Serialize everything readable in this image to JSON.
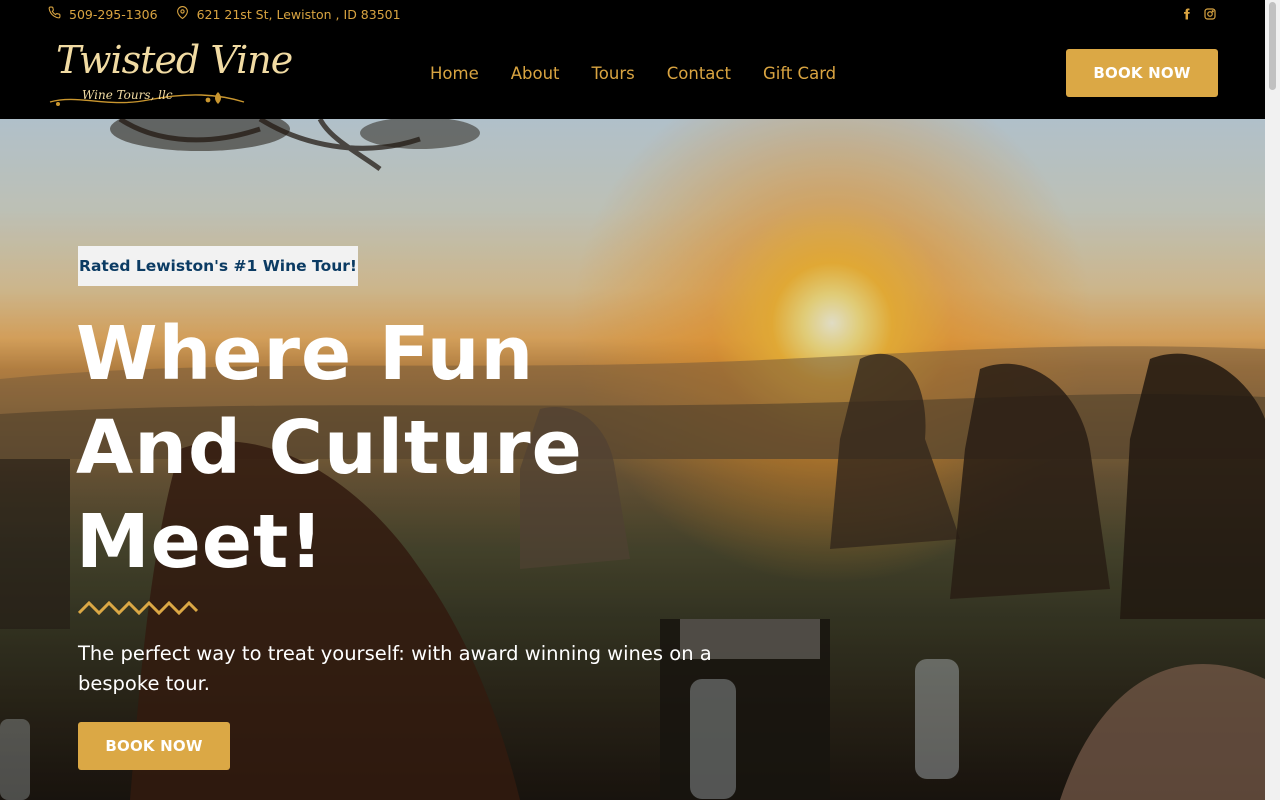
{
  "topbar": {
    "phone": "509-295-1306",
    "address": "621 21st St, Lewiston , ID 83501",
    "icons": {
      "phone": "phone-icon",
      "location": "map-pin-icon",
      "facebook": "facebook-icon",
      "instagram": "instagram-icon"
    }
  },
  "header": {
    "logo": {
      "brand": "Twisted Vine",
      "subtitle": "Wine Tours, llc"
    },
    "nav": [
      {
        "label": "Home"
      },
      {
        "label": "About"
      },
      {
        "label": "Tours"
      },
      {
        "label": "Contact"
      },
      {
        "label": "Gift Card"
      }
    ],
    "cta": "BOOK NOW"
  },
  "hero": {
    "badge": "Rated Lewiston's #1 Wine Tour!",
    "headline_lines": [
      "Where Fun",
      "And Culture",
      "Meet!"
    ],
    "subtext": "The perfect way to treat yourself: with award winning wines on a bespoke tour.",
    "cta": "BOOK NOW"
  },
  "colors": {
    "accent": "#dba845",
    "nav_text": "#d9a441",
    "logo_text": "#f1dba3",
    "badge_text": "#0b3b63",
    "badge_bg": "#f2f2f2",
    "header_bg": "#000000"
  }
}
